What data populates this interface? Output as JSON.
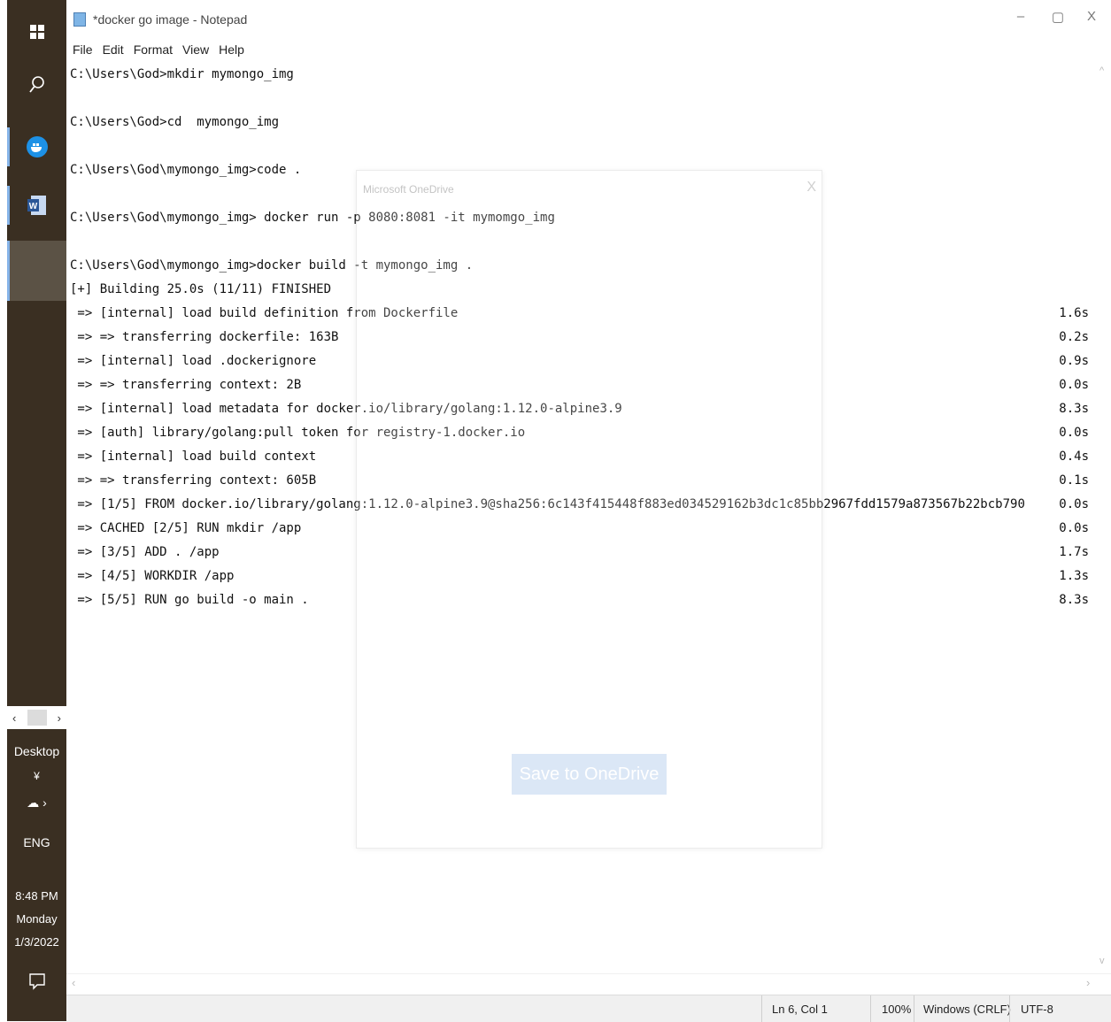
{
  "taskbar": {
    "desktop_label": "Desktop",
    "language": "ENG",
    "time": "8:48 PM",
    "day": "Monday",
    "date": "1/3/2022"
  },
  "window": {
    "title": "*docker go image - Notepad",
    "controls": {
      "minimize": "–",
      "maximize": "▢",
      "close": "X"
    }
  },
  "menu": [
    "File",
    "Edit",
    "Format",
    "View",
    "Help"
  ],
  "editor": {
    "lines": [
      {
        "text": "C:\\Users\\God>mkdir mymongo_img",
        "dur": ""
      },
      {
        "text": "",
        "dur": ""
      },
      {
        "text": "C:\\Users\\God>cd  mymongo_img",
        "dur": ""
      },
      {
        "text": "",
        "dur": ""
      },
      {
        "text": "C:\\Users\\God\\mymongo_img>code .",
        "dur": ""
      },
      {
        "text": "",
        "dur": ""
      },
      {
        "text": "C:\\Users\\God\\mymongo_img> docker run -p 8080:8081 -it mymomgo_img",
        "dur": ""
      },
      {
        "text": "",
        "dur": ""
      },
      {
        "text": "C:\\Users\\God\\mymongo_img>docker build -t mymongo_img .",
        "dur": ""
      },
      {
        "text": "[+] Building 25.0s (11/11) FINISHED",
        "dur": ""
      },
      {
        "text": " => [internal] load build definition from Dockerfile",
        "dur": "1.6s"
      },
      {
        "text": " => => transferring dockerfile: 163B",
        "dur": "0.2s"
      },
      {
        "text": " => [internal] load .dockerignore",
        "dur": "0.9s"
      },
      {
        "text": " => => transferring context: 2B",
        "dur": "0.0s"
      },
      {
        "text": " => [internal] load metadata for docker.io/library/golang:1.12.0-alpine3.9",
        "dur": "8.3s"
      },
      {
        "text": " => [auth] library/golang:pull token for registry-1.docker.io",
        "dur": "0.0s"
      },
      {
        "text": " => [internal] load build context",
        "dur": "0.4s"
      },
      {
        "text": " => => transferring context: 605B",
        "dur": "0.1s"
      },
      {
        "text": " => [1/5] FROM docker.io/library/golang:1.12.0-alpine3.9@sha256:6c143f415448f883ed034529162b3dc1c85bb2967fdd1579a873567b22bcb790",
        "dur": "0.0s"
      },
      {
        "text": " => CACHED [2/5] RUN mkdir /app",
        "dur": "0.0s"
      },
      {
        "text": " => [3/5] ADD . /app",
        "dur": "1.7s"
      },
      {
        "text": " => [4/5] WORKDIR /app",
        "dur": "1.3s"
      },
      {
        "text": " => [5/5] RUN go build -o main .",
        "dur": "8.3s"
      }
    ]
  },
  "dialog": {
    "title": "Microsoft OneDrive",
    "close": "X",
    "button": "Save to OneDrive"
  },
  "status": {
    "position": "Ln 6, Col 1",
    "zoom": "100%",
    "line_ending": "Windows (CRLF)",
    "encoding": "UTF-8"
  }
}
